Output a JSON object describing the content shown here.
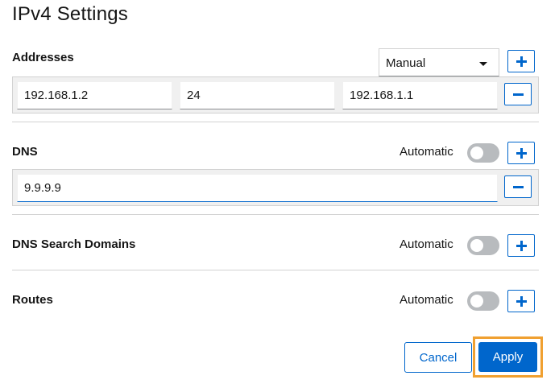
{
  "title": "IPv4 Settings",
  "addresses": {
    "label": "Addresses",
    "method": "Manual",
    "address": "192.168.1.2",
    "prefix": "24",
    "gateway": "192.168.1.1"
  },
  "dns": {
    "label": "DNS",
    "automatic_label": "Automatic",
    "automatic_on": false,
    "server": "9.9.9.9"
  },
  "dns_search": {
    "label": "DNS Search Domains",
    "automatic_label": "Automatic",
    "automatic_on": false
  },
  "routes": {
    "label": "Routes",
    "automatic_label": "Automatic",
    "automatic_on": false
  },
  "actions": {
    "cancel_label": "Cancel",
    "apply_label": "Apply"
  },
  "colors": {
    "accent": "#0066cc",
    "focus_highlight": "#f0a030",
    "toggle_off": "#b8bbbe"
  },
  "icons": [
    "plus-icon",
    "minus-icon",
    "caret-down-icon"
  ]
}
